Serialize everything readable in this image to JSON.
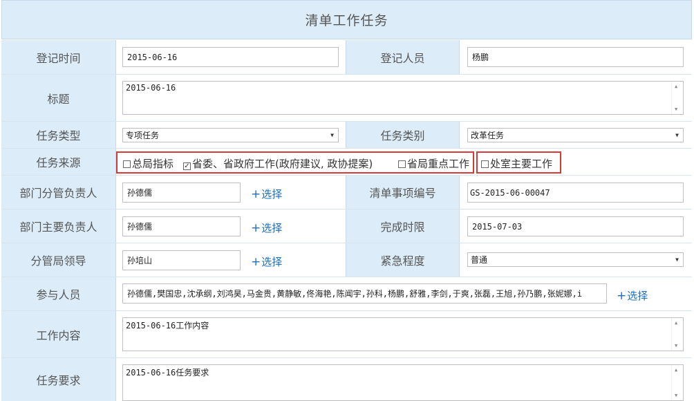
{
  "page_title": "清单工作任务",
  "fields": {
    "register_time": {
      "label": "登记时间",
      "value": "2015-06-16"
    },
    "register_person": {
      "label": "登记人员",
      "value": "杨鹏"
    },
    "title": {
      "label": "标题",
      "value": "2015-06-16"
    },
    "task_type": {
      "label": "任务类型",
      "value": "专项任务"
    },
    "task_category": {
      "label": "任务类别",
      "value": "改革任务"
    },
    "task_source": {
      "label": "任务来源",
      "options": [
        {
          "label": "总局指标",
          "checked": false
        },
        {
          "label": "省委、省政府工作(政府建议, 政协提案)",
          "checked": true
        },
        {
          "label": "省局重点工作",
          "checked": false
        },
        {
          "label": "处室主要工作",
          "checked": false
        }
      ]
    },
    "dept_deputy": {
      "label": "部门分管负责人",
      "value": "孙德儒"
    },
    "list_item_no": {
      "label": "清单事项编号",
      "value": "GS-2015-06-00047"
    },
    "dept_head": {
      "label": "部门主要负责人",
      "value": "孙德儒"
    },
    "deadline": {
      "label": "完成时限",
      "value": "2015-07-03"
    },
    "bureau_leader": {
      "label": "分管局领导",
      "value": "孙培山"
    },
    "urgency": {
      "label": "紧急程度",
      "value": "普通"
    },
    "participants": {
      "label": "参与人员",
      "value": "孙德儒,樊国忠,沈承纲,刘鸿昊,马金贵,黄静敏,佟海艳,陈闻宇,孙科,杨鹏,舒雅,李剑,于爽,张磊,王旭,孙乃鹏,张妮娜,i"
    },
    "work_content": {
      "label": "工作内容",
      "value": "2015-06-16工作内容"
    },
    "task_requirement": {
      "label": "任务要求",
      "value": "2015-06-16任务要求"
    }
  },
  "select_label": "选择",
  "plus_symbol": "+",
  "icons": {
    "dropdown": "▼",
    "scroll_up": "▲",
    "scroll_down": "▼",
    "check": "✓"
  }
}
